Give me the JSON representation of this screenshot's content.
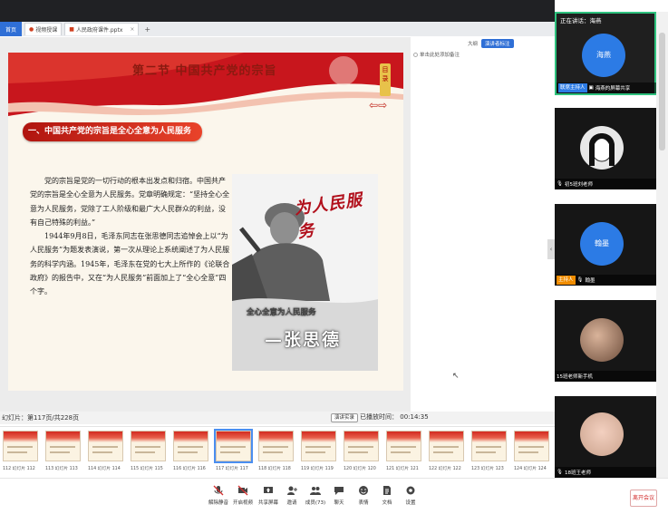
{
  "tabs": {
    "home": "首页",
    "t1": "视频授课",
    "t2": "人民政府课件.pptx",
    "plus": "+"
  },
  "slide": {
    "title": "第二节  中国共产党的宗旨",
    "badge": "目录",
    "heading": "一、中国共产党的宗旨是全心全意为人民服务",
    "para1": "党的宗旨是党的一切行动的根本出发点和归宿。中国共产党的宗旨是全心全意为人民服务。党章明确规定：“坚持全心全意为人民服务，党除了工人阶级和最广大人民群众的利益，没有自己特殊的利益。”",
    "para2": "1944年9月8日，毛泽东同志在张思德同志追悼会上以“为人民服务”为题发表演说，第一次从理论上系统阐述了为人民服务的科学内涵。1945年，毛泽东在党的七大上所作的《论联合政府》的报告中，又在“为人民服务”前面加上了“全心全意”四个字。",
    "poster_calligraphy": "为人民服务",
    "poster_slogan": "全心全意为人民服务",
    "poster_name": "—张思德"
  },
  "side": {
    "top_label": "大纲",
    "top_btn": "演讲者标注",
    "placeholder": "单击此处添加备注"
  },
  "status": {
    "text": "幻灯片：第117页/共228页",
    "end_button": "演讲实录",
    "timer_label": "已播放时间：",
    "timer": "00:14:35"
  },
  "thumbnails": [
    {
      "label": "112 幻灯片 112"
    },
    {
      "label": "113 幻灯片 113"
    },
    {
      "label": "114 幻灯片 114"
    },
    {
      "label": "115 幻灯片 115"
    },
    {
      "label": "116 幻灯片 116"
    },
    {
      "label": "117 幻灯片 117"
    },
    {
      "label": "118 幻灯片 118"
    },
    {
      "label": "119 幻灯片 119"
    },
    {
      "label": "120 幻灯片 120"
    },
    {
      "label": "121 幻灯片 121"
    },
    {
      "label": "122 幻灯片 122"
    },
    {
      "label": "123 幻灯片 123"
    },
    {
      "label": "124 幻灯片 124"
    }
  ],
  "toolbar": {
    "mic": "解除静音",
    "video": "开启视频",
    "share": "共享屏幕",
    "invite": "邀请",
    "members": "成员(73)",
    "chat": "聊天",
    "react": "表情",
    "docs": "文档",
    "settings": "设置",
    "leave": "离开会议"
  },
  "participants": {
    "speaking": "正在讲话：海燕",
    "p1_avatar": "海燕",
    "p1_role": "联席主持人",
    "p1_name": "海燕的屏幕共享",
    "p2_name": "初5班刘老师",
    "p3_avatar": "翰墨",
    "p3_role": "主持人",
    "p3_name": "翰墨",
    "p4_name": "15班老师新手机",
    "p5_name": "18班王老师"
  },
  "colors": {
    "accent": "#2f6fd6",
    "leave": "#d32f2f",
    "slide_red": "#c8161d"
  }
}
